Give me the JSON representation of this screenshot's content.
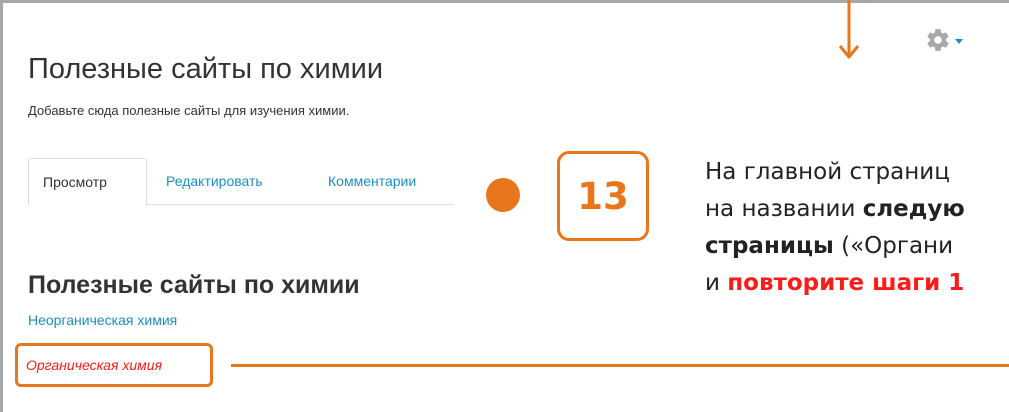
{
  "page": {
    "title": "Полезные сайты по химии",
    "description": "Добавьте сюда полезные сайты для изучения химии."
  },
  "toolbar": {
    "settings_icon": "gear-icon",
    "settings_caret_icon": "caret-down-icon"
  },
  "tabs": [
    {
      "label": "Просмотр",
      "active": true
    },
    {
      "label": "Редактировать",
      "active": false
    },
    {
      "label": "Комментарии",
      "active": false
    }
  ],
  "content": {
    "heading": "Полезные сайты по химии",
    "links": [
      {
        "label": "Неорганическая химия"
      },
      {
        "label": "Органическая химия"
      }
    ]
  },
  "annotation": {
    "step_number": "13",
    "line1": "На главной страниц",
    "line2_plain": "на названии ",
    "line2_bold": "следую",
    "line3_bold": "страницы",
    "line3_plain": " («Органи",
    "line4_plain": "и ",
    "line4_red": "повторите шаги 1",
    "accent_color": "#e8761c",
    "highlight_color": "#ff1a1a"
  },
  "colors": {
    "link": "#1a8fc9",
    "text": "#333333"
  }
}
